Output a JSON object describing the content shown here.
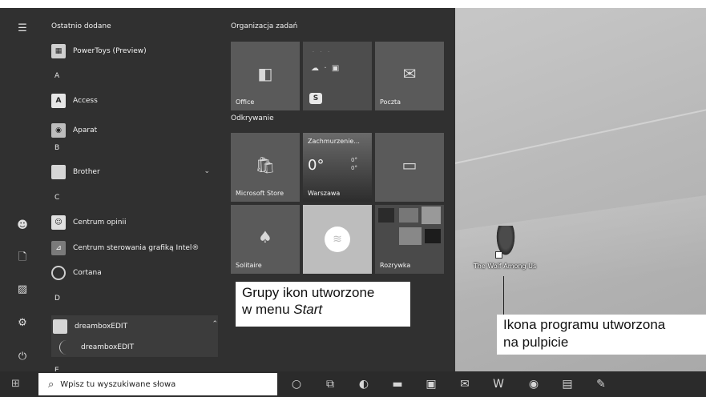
{
  "start_menu": {
    "recent_header": "Ostatnio dodane",
    "rail_icons": [
      "menu-icon",
      "user-icon",
      "document-icon",
      "pictures-icon",
      "settings-icon",
      "power-icon"
    ],
    "apps": [
      {
        "label": "PowerToys (Preview)",
        "icon": "powertoys-icon"
      },
      {
        "letter": "A"
      },
      {
        "label": "Access",
        "icon": "access-icon"
      },
      {
        "label": "Aparat",
        "icon": "camera-icon"
      },
      {
        "letter": "B"
      },
      {
        "label": "Brother",
        "icon": "folder-icon",
        "expandable": true
      },
      {
        "letter": "C"
      },
      {
        "label": "Centrum opinii",
        "icon": "feedback-icon"
      },
      {
        "label": "Centrum sterowania grafiką Intel®",
        "icon": "intel-graphics-icon"
      },
      {
        "label": "Cortana",
        "icon": "cortana-icon"
      },
      {
        "letter": "D"
      },
      {
        "label": "dreamboxEDIT",
        "icon": "folder-icon",
        "expanded": true
      },
      {
        "label": "dreamboxEDIT",
        "icon": "dreambox-icon",
        "child": true
      },
      {
        "letter": "E"
      }
    ],
    "groups": [
      {
        "title": "Organizacja zadań"
      },
      {
        "title": "Odkrywanie"
      }
    ],
    "tiles": {
      "office": "Office",
      "poczta": "Poczta",
      "store": "Microsoft Store",
      "weather_title": "Zachmurzenie...",
      "weather_temp": "0°",
      "weather_hi": "0°",
      "weather_lo": "0°",
      "weather_city": "Warszawa",
      "solitaire": "Solitaire",
      "rozrywka": "Rozrywka",
      "skype_badge": "S"
    }
  },
  "callouts": {
    "groups_line1": "Grupy ikon utworzone",
    "groups_line2_prefix": "w menu ",
    "groups_line2_em": "Start",
    "desktop_line1": "Ikona programu utworzona",
    "desktop_line2": "na pulpicie"
  },
  "desktop_icon": {
    "label": "The Wolf Among Us"
  },
  "taskbar": {
    "search_placeholder": "Wpisz tu wyszukiwane słowa",
    "icons": [
      "cortana-circle-icon",
      "task-view-icon",
      "edge-icon",
      "file-explorer-icon",
      "store-icon",
      "mail-icon",
      "word-icon",
      "chrome-icon",
      "save-icon",
      "paint-icon"
    ]
  }
}
